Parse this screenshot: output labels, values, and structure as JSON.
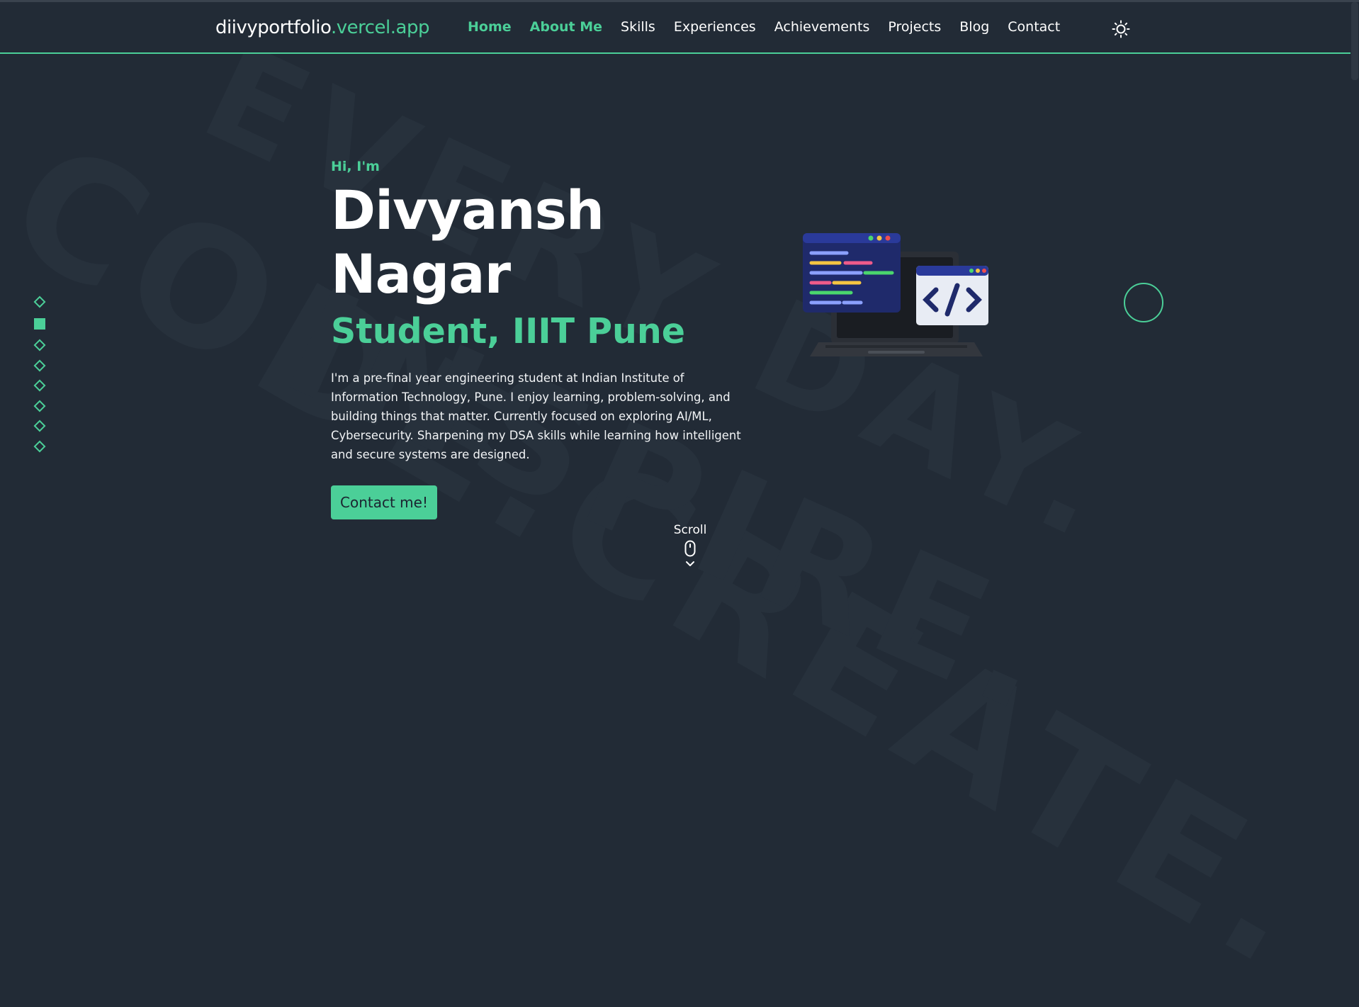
{
  "background": {
    "line1": "EVERY DAY.",
    "line2": "CODE.CREATE.",
    "line3": "INSPIRE."
  },
  "brand": {
    "part1": "diivyportfolio",
    "part2": ".vercel.app"
  },
  "nav": {
    "items": [
      {
        "label": "Home",
        "active": true
      },
      {
        "label": "About Me",
        "active": true
      },
      {
        "label": "Skills"
      },
      {
        "label": "Experiences"
      },
      {
        "label": "Achievements"
      },
      {
        "label": "Projects"
      },
      {
        "label": "Blog"
      },
      {
        "label": "Contact"
      }
    ],
    "theme_toggle_icon": "sun-icon"
  },
  "sidebar": {
    "dot_count": 8,
    "active_index": 1
  },
  "hero": {
    "greeting": "Hi, I'm",
    "name": "Divyansh Nagar",
    "role": "Student, IIIT Pune",
    "bio": "I'm a pre-final year engineering student at Indian Institute of Information Technology, Pune. I enjoy learning, problem-solving, and building things that matter. Currently focused on exploring AI/ML, Cybersecurity. Sharpening my DSA skills while learning how intelligent and secure systems are designed.",
    "cta": "Contact me!"
  },
  "scroll": {
    "label": "Scroll"
  },
  "colors": {
    "accent": "#4bcf98",
    "background": "#222b36",
    "text": "#ffffff"
  }
}
